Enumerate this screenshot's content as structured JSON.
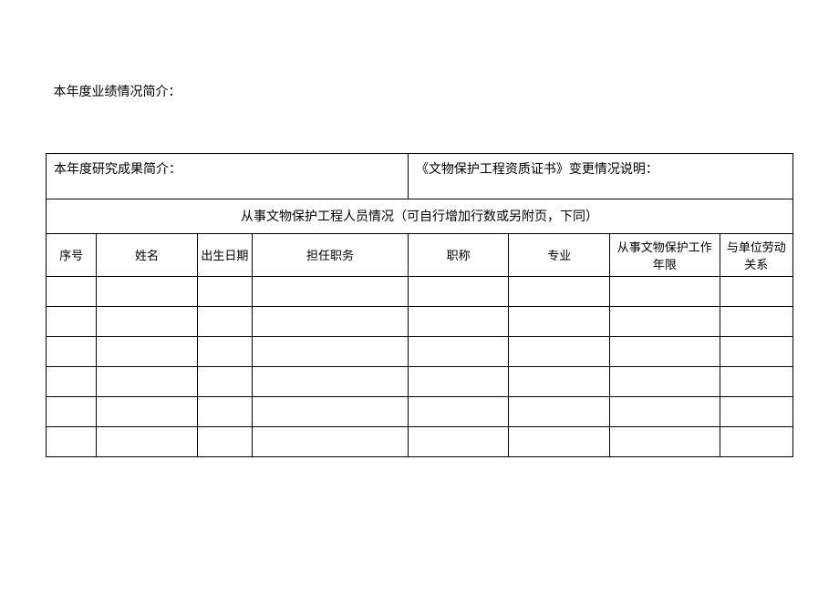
{
  "sections": {
    "performance_intro_label": "本年度业绩情况简介：",
    "research_intro_label": "本年度研究成果简介：",
    "cert_change_label": "《文物保护工程资质证书》变更情况说明：",
    "personnel_section_label": "从事文物保护工程人员情况（可自行增加行数或另附页，下同）"
  },
  "table": {
    "headers": {
      "seq": "序号",
      "name": "姓名",
      "dob": "出生日期",
      "duty": "担任职务",
      "title": "职称",
      "major": "专业",
      "years": "从事文物保护工作年限",
      "relation": "与单位劳动关系"
    },
    "rows": [
      {
        "seq": "",
        "name": "",
        "dob": "",
        "duty": "",
        "title": "",
        "major": "",
        "years": "",
        "relation": ""
      },
      {
        "seq": "",
        "name": "",
        "dob": "",
        "duty": "",
        "title": "",
        "major": "",
        "years": "",
        "relation": ""
      },
      {
        "seq": "",
        "name": "",
        "dob": "",
        "duty": "",
        "title": "",
        "major": "",
        "years": "",
        "relation": ""
      },
      {
        "seq": "",
        "name": "",
        "dob": "",
        "duty": "",
        "title": "",
        "major": "",
        "years": "",
        "relation": ""
      },
      {
        "seq": "",
        "name": "",
        "dob": "",
        "duty": "",
        "title": "",
        "major": "",
        "years": "",
        "relation": ""
      },
      {
        "seq": "",
        "name": "",
        "dob": "",
        "duty": "",
        "title": "",
        "major": "",
        "years": "",
        "relation": ""
      }
    ]
  }
}
